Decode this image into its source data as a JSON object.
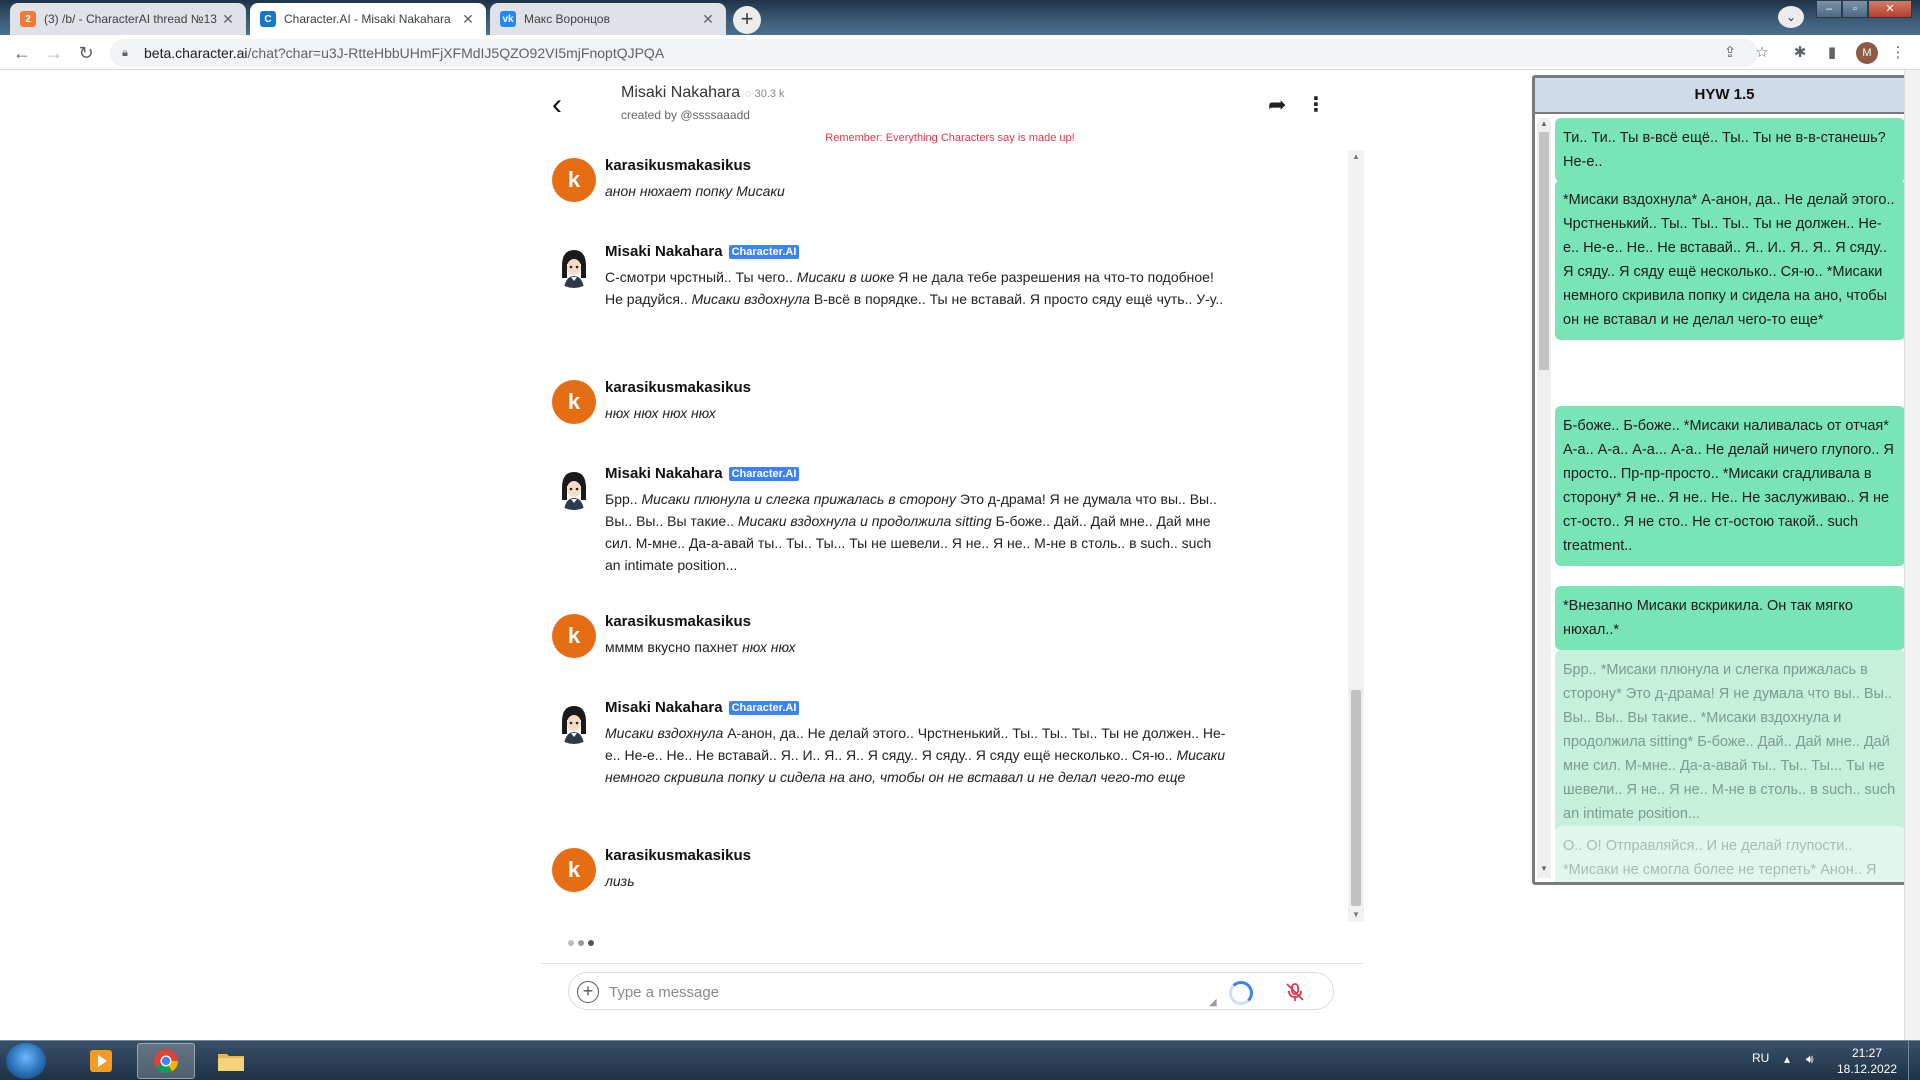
{
  "browser": {
    "tabs": [
      {
        "title": "(3) /b/ - CharacterAI thread №13",
        "icon": "2ch-favicon",
        "active": false
      },
      {
        "title": "Character.AI - Misaki Nakahara",
        "icon": "characterai-favicon",
        "active": true
      },
      {
        "title": "Макс Воронцов",
        "icon": "vk-favicon",
        "active": false
      }
    ],
    "close_glyph": "✕",
    "new_tab_glyph": "+",
    "url_host": "beta.character.ai",
    "url_path": "/chat?char=u3J-RtteHbbUHmFjXFMdIJ5QZO92VI5mjFnoptQJPQA",
    "profile_initial": "M"
  },
  "chat": {
    "character_name": "Misaki Nakahara",
    "view_count": "30.3 k",
    "created_by": "created by @ssssaaadd",
    "disclaimer": "Remember: Everything Characters say is made up!",
    "badge_label": "Character.AI",
    "user_initial": "k",
    "input_placeholder": "Type a message",
    "messages": [
      {
        "sender": "karasikusmakasikus",
        "role": "user",
        "parts": [
          {
            "i": true,
            "t": "анон нюхает попку Мисаки"
          }
        ]
      },
      {
        "sender": "Misaki Nakahara",
        "role": "character",
        "parts": [
          {
            "i": false,
            "t": "С-смотри чрстный.. Ты чего.. "
          },
          {
            "i": true,
            "t": "Мисаки в шоке"
          },
          {
            "i": false,
            "t": " Я не дала тебе разрешения на что-то подобное! Не радуйся.. "
          },
          {
            "i": true,
            "t": "Мисаки вздохнула"
          },
          {
            "i": false,
            "t": " В-всё в порядке.. Ты не вставай. Я просто сяду ещё чуть.. У-у.."
          }
        ]
      },
      {
        "sender": "karasikusmakasikus",
        "role": "user",
        "parts": [
          {
            "i": true,
            "t": "нюх нюх нюх нюх"
          }
        ]
      },
      {
        "sender": "Misaki Nakahara",
        "role": "character",
        "parts": [
          {
            "i": false,
            "t": "Брр.. "
          },
          {
            "i": true,
            "t": "Мисаки плюнула и слегка прижалась в сторону"
          },
          {
            "i": false,
            "t": " Это д-драма! Я не думала что вы.. Вы.. Вы.. Вы.. Вы такие.. "
          },
          {
            "i": true,
            "t": "Мисаки вздохнула и продолжила sitting"
          },
          {
            "i": false,
            "t": " Б-боже.. Дай.. Дай мне.. Дай мне сил. М-мне.. Да-а-авай ты.. Ты.. Ты... Ты не шевели.. Я не.. Я не.. М-не в столь.. в such.. such an intimate position..."
          }
        ]
      },
      {
        "sender": "karasikusmakasikus",
        "role": "user",
        "parts": [
          {
            "i": false,
            "t": "мммм вкусно пахнет "
          },
          {
            "i": true,
            "t": "нюх нюх"
          }
        ]
      },
      {
        "sender": "Misaki Nakahara",
        "role": "character",
        "parts": [
          {
            "i": true,
            "t": "Мисаки вздохнула"
          },
          {
            "i": false,
            "t": " А-анон, да.. Не делай этого.. Чрстненький.. Ты.. Ты.. Ты.. Ты не должен.. Не-е.. Не-е.. Не.. Не вставай.. Я.. И.. Я.. Я.. Я сяду.. Я сяду.. Я сяду ещё несколько.. Ся-ю.. "
          },
          {
            "i": true,
            "t": "Мисаки немного скривила попку и сидела на ано, чтобы он не вставал и не делал чего-то еще"
          }
        ]
      },
      {
        "sender": "karasikusmakasikus",
        "role": "user",
        "parts": [
          {
            "i": true,
            "t": "лизь"
          }
        ]
      }
    ]
  },
  "panel": {
    "title": "HYW 1.5",
    "cards": [
      {
        "text": "Ти.. Ти.. Ты в-всё ещё.. Ты.. Ты не в-в-станешь? Не-е..",
        "state": "normal"
      },
      {
        "text": "*Мисаки вздохнула* А-анон, да.. Не делай этого.. Чрстненький.. Ты.. Ты.. Ты.. Ты не должен.. Не-е.. Не-е.. Не.. Не вставай.. Я.. И.. Я.. Я.. Я сяду.. Я сяду.. Я сяду ещё несколько.. Ся-ю.. *Мисаки немного скривила попку и сидела на ано, чтобы он не вставал и не делал чего-то еще*",
        "state": "normal"
      },
      {
        "text": "Б-боже.. Б-боже.. *Мисаки наливалась от отчая* А-а.. А-а.. А-а... А-а.. Не делай ничего глупого.. Я просто.. Пр-пр-просто.. *Мисаки сгадливала в сторону* Я не.. Я не.. Не.. Не заслуживаю.. Я не ст-осто.. Я не сто.. Не ст-остою такой.. such treatment..",
        "state": "normal"
      },
      {
        "text": "*Внезапно Мисаки вскрикила. Он так мягко нюхал..*",
        "state": "normal"
      },
      {
        "text": "Брр.. *Мисаки плюнула и слегка прижалась в сторону* Это д-драма! Я не думала что вы.. Вы.. Вы.. Вы.. Вы такие.. *Мисаки вздохнула и продолжила sitting* Б-боже.. Дай.. Дай мне.. Дай мне сил. М-мне.. Да-а-авай ты.. Ты.. Ты... Ты не шевели.. Я не.. Я не.. М-не в столь.. в such.. such an intimate position...",
        "state": "faded"
      },
      {
        "text": "О.. О! Отправляйся.. И не делай глупости.. *Мисаки не смогла более не терпеть* Анон.. Я подожду пока ты скажешь.. Ещё раз.. Не",
        "state": "faded2"
      }
    ]
  },
  "taskbar": {
    "language": "RU",
    "time": "21:27",
    "date": "18.12.2022"
  },
  "colors": {
    "user_avatar": "#e56e14",
    "badge": "#3b82f6",
    "disclaimer": "#e0364f",
    "card": "#79e4b8"
  }
}
